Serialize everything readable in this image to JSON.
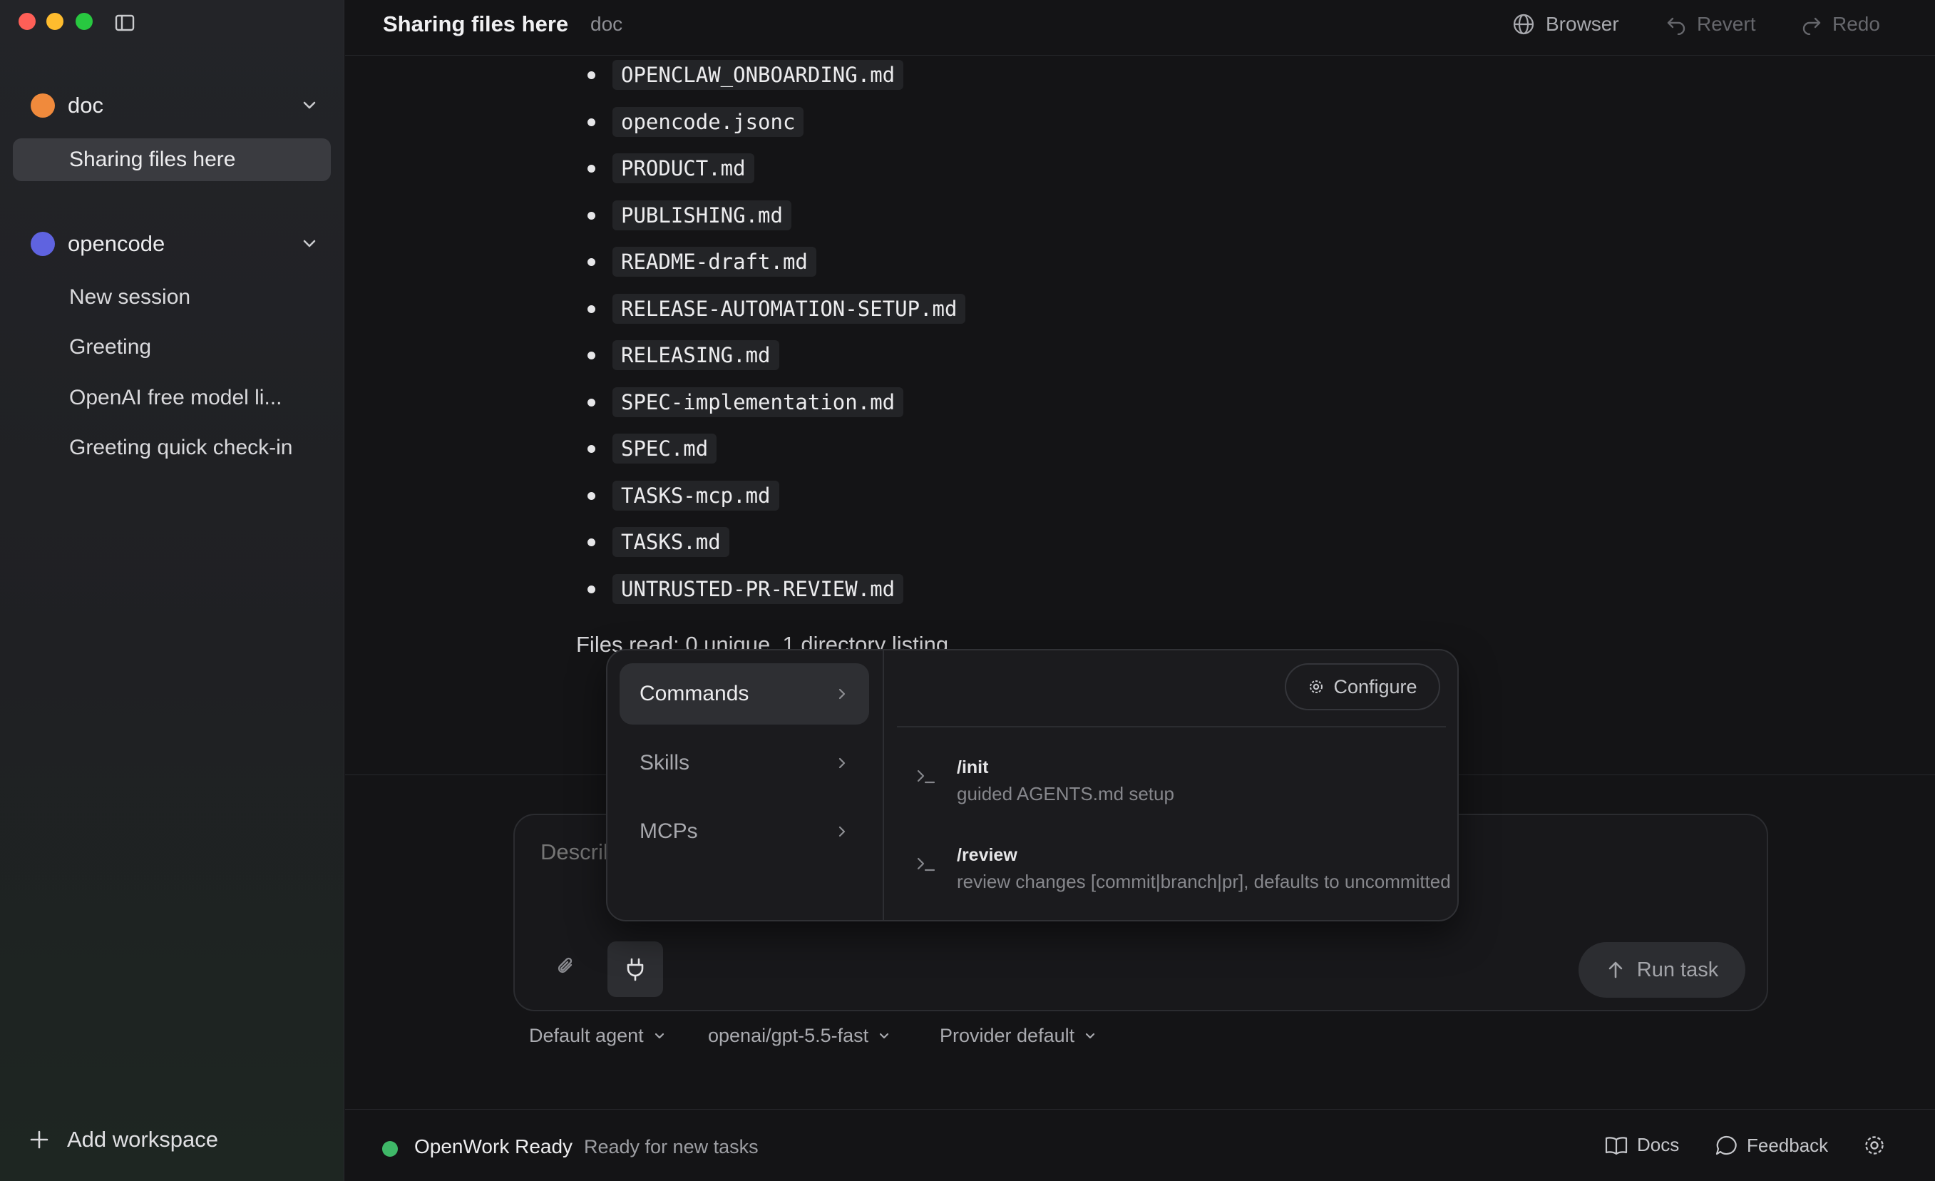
{
  "window": {
    "title": "Sharing files here",
    "subtitle": "doc"
  },
  "sidebar": {
    "workspaces": [
      {
        "name": "doc",
        "color": "#f08a3c",
        "sessions": [
          {
            "label": "Sharing files here",
            "active": true
          }
        ]
      },
      {
        "name": "opencode",
        "color": "#5f63e0",
        "sessions": [
          {
            "label": "New session",
            "active": false
          },
          {
            "label": "Greeting",
            "active": false
          },
          {
            "label": "OpenAI free model li...",
            "active": false
          },
          {
            "label": "Greeting quick check-in",
            "active": false
          }
        ]
      }
    ],
    "add_workspace_label": "Add workspace"
  },
  "topbar": {
    "browser_label": "Browser",
    "revert_label": "Revert",
    "redo_label": "Redo"
  },
  "content": {
    "files": [
      "OPENCLAW_ONBOARDING.md",
      "opencode.jsonc",
      "PRODUCT.md",
      "PUBLISHING.md",
      "README-draft.md",
      "RELEASE-AUTOMATION-SETUP.md",
      "RELEASING.md",
      "SPEC-implementation.md",
      "SPEC.md",
      "TASKS-mcp.md",
      "TASKS.md",
      "UNTRUSTED-PR-REVIEW.md"
    ],
    "files_read": "Files read: 0 unique, 1 directory listing"
  },
  "popover": {
    "menu": [
      {
        "label": "Commands",
        "active": true
      },
      {
        "label": "Skills",
        "active": false
      },
      {
        "label": "MCPs",
        "active": false
      }
    ],
    "configure_label": "Configure",
    "commands": [
      {
        "name": "/init",
        "description": "guided AGENTS.md setup"
      },
      {
        "name": "/review",
        "description": "review changes [commit|branch|pr], defaults to uncommitted"
      }
    ]
  },
  "composer": {
    "placeholder": "Describe your task...",
    "run_label": "Run task",
    "agent": "Default agent",
    "model": "openai/gpt-5.5-fast",
    "provider": "Provider default"
  },
  "status": {
    "title": "OpenWork Ready",
    "text": "Ready for new tasks",
    "color": "#3fb868",
    "docs_label": "Docs",
    "feedback_label": "Feedback"
  }
}
